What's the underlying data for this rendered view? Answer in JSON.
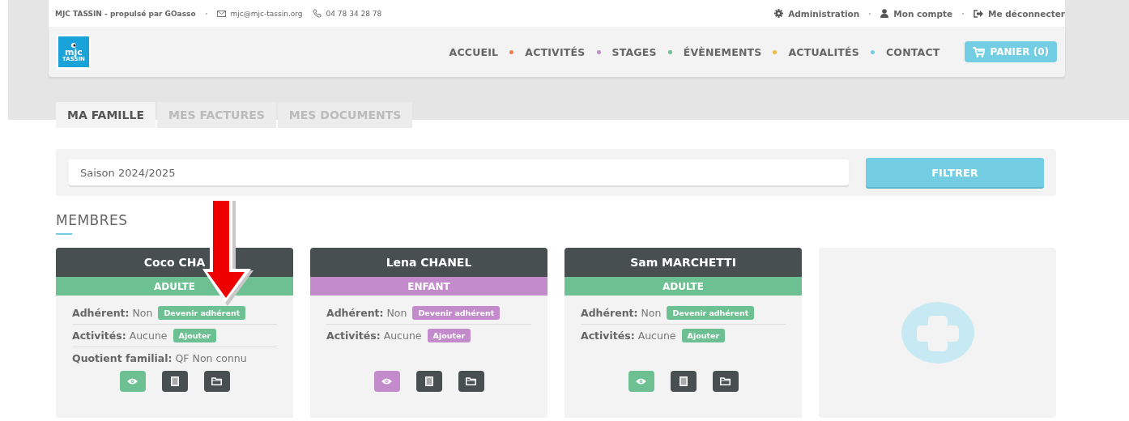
{
  "topbar": {
    "site": "MJC TASSIN - propulsé par GOasso",
    "email": "mjc@mjc-tassin.org",
    "phone": "04 78 34 28 78",
    "links": [
      {
        "label": "Administration"
      },
      {
        "label": "Mon compte"
      },
      {
        "label": "Me déconnecter"
      }
    ]
  },
  "logo": {
    "text": "mjc",
    "subtext": "TASSIN"
  },
  "nav": [
    {
      "label": "ACCUEIL",
      "color": "#ef7d4b"
    },
    {
      "label": "ACTIVITÉS",
      "color": "#c38acc"
    },
    {
      "label": "STAGES",
      "color": "#6cc091"
    },
    {
      "label": "ÉVÈNEMENTS",
      "color": "#f2b93b"
    },
    {
      "label": "ACTUALITÉS",
      "color": "#73cde3"
    },
    {
      "label": "CONTACT"
    }
  ],
  "cart": {
    "label": "PANIER (0)"
  },
  "tabs": [
    {
      "label": "MA FAMILLE",
      "selected": true
    },
    {
      "label": "MES FACTURES",
      "selected": false
    },
    {
      "label": "MES DOCUMENTS",
      "selected": false
    }
  ],
  "filter": {
    "value": "Saison 2024/2025",
    "button": "FILTRER"
  },
  "section_title": "MEMBRES",
  "members": [
    {
      "name": "Coco CHA",
      "type": "ADULTE",
      "color": "#6cc091",
      "rows": [
        {
          "label": "Adhérent:",
          "value": "Non",
          "action": "Devenir adhérent"
        },
        {
          "label": "Activités:",
          "value": "Aucune",
          "action": "Ajouter"
        },
        {
          "label": "Quotient familial:",
          "value": "QF Non connu"
        }
      ]
    },
    {
      "name": "Lena CHANEL",
      "type": "ENFANT",
      "color": "#c38acc",
      "rows": [
        {
          "label": "Adhérent:",
          "value": "Non",
          "action": "Devenir adhérent"
        },
        {
          "label": "Activités:",
          "value": "Aucune",
          "action": "Ajouter"
        }
      ]
    },
    {
      "name": "Sam MARCHETTI",
      "type": "ADULTE",
      "color": "#6cc091",
      "rows": [
        {
          "label": "Adhérent:",
          "value": "Non",
          "action": "Devenir adhérent"
        },
        {
          "label": "Activités:",
          "value": "Aucune",
          "action": "Ajouter"
        }
      ]
    }
  ],
  "add_member": {
    "kind": "plus"
  },
  "annotation": {
    "kind": "arrow"
  }
}
